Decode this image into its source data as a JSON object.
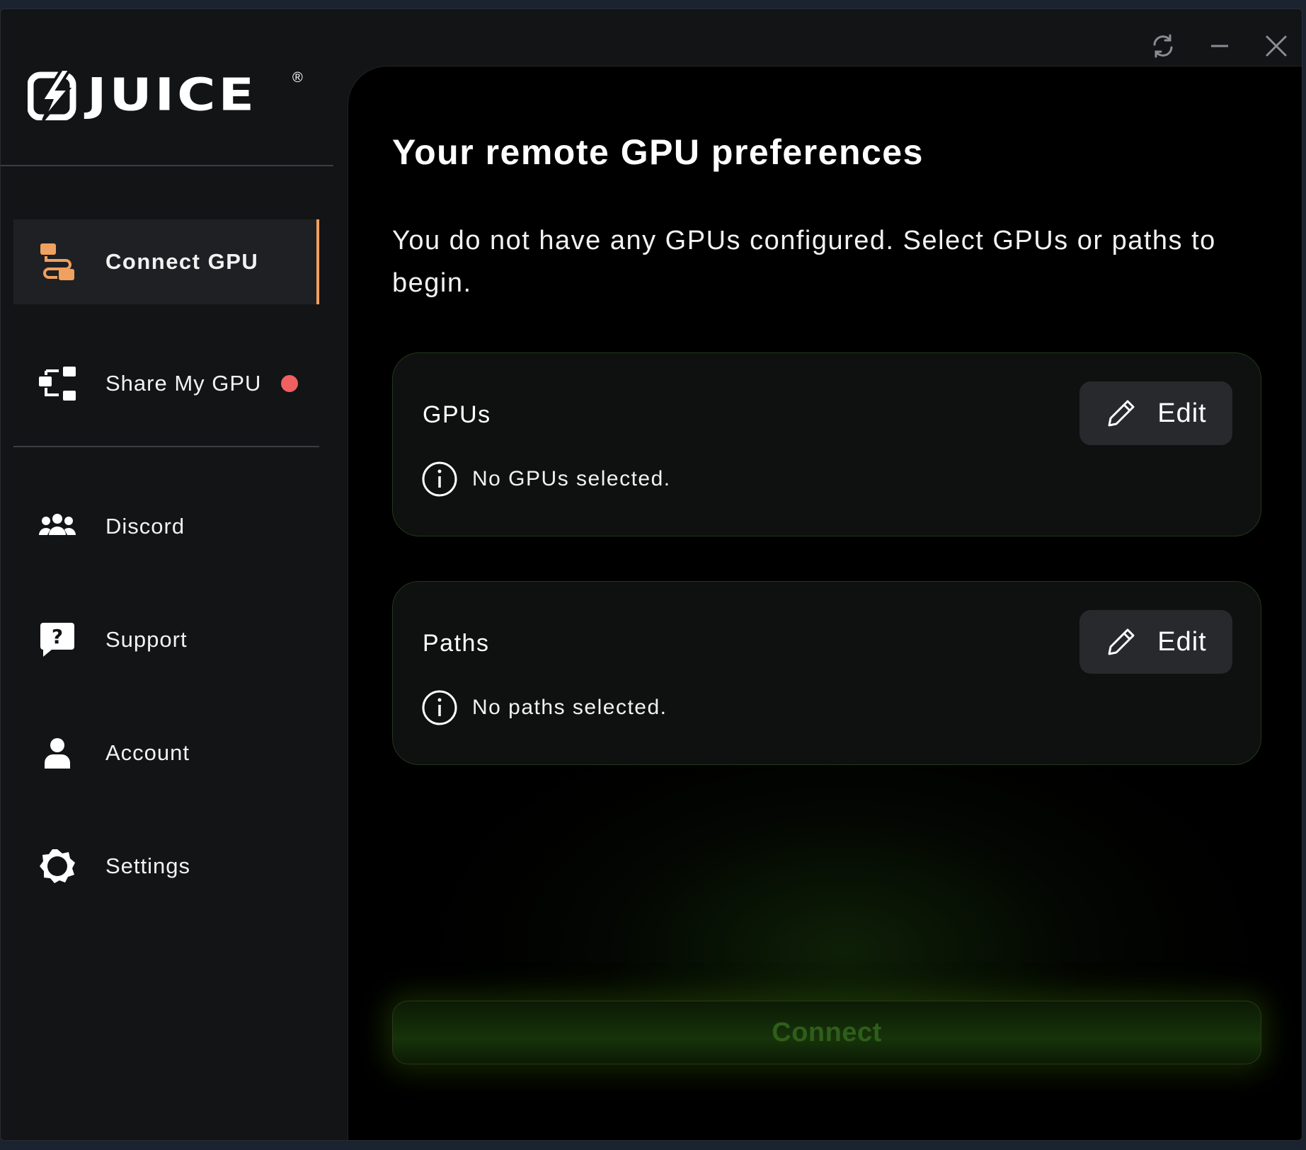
{
  "window": {
    "controls": {
      "refresh": "refresh-icon",
      "minimize": "minimize-icon",
      "close": "close-icon"
    }
  },
  "brand": {
    "name": "JUICE",
    "registered": "®"
  },
  "sidebar": {
    "items": [
      {
        "label": "Connect GPU",
        "icon": "connect-gpu-icon",
        "active": true
      },
      {
        "label": "Share My GPU",
        "icon": "share-gpu-icon",
        "badge": true
      },
      {
        "label": "Discord",
        "icon": "users-icon"
      },
      {
        "label": "Support",
        "icon": "help-chat-icon"
      },
      {
        "label": "Account",
        "icon": "person-icon"
      },
      {
        "label": "Settings",
        "icon": "gear-icon"
      }
    ]
  },
  "main": {
    "title": "Your remote GPU preferences",
    "subtitle": "You do not have any GPUs configured. Select GPUs or paths to begin.",
    "gpus": {
      "title": "GPUs",
      "edit_label": "Edit",
      "info": "No GPUs selected."
    },
    "paths": {
      "title": "Paths",
      "edit_label": "Edit",
      "info": "No paths selected."
    },
    "connect_label": "Connect"
  },
  "colors": {
    "accent": "#f0a05f",
    "badge": "#f06060",
    "card_border": "#1f3a1a",
    "connect_text": "#2f5e1a"
  }
}
